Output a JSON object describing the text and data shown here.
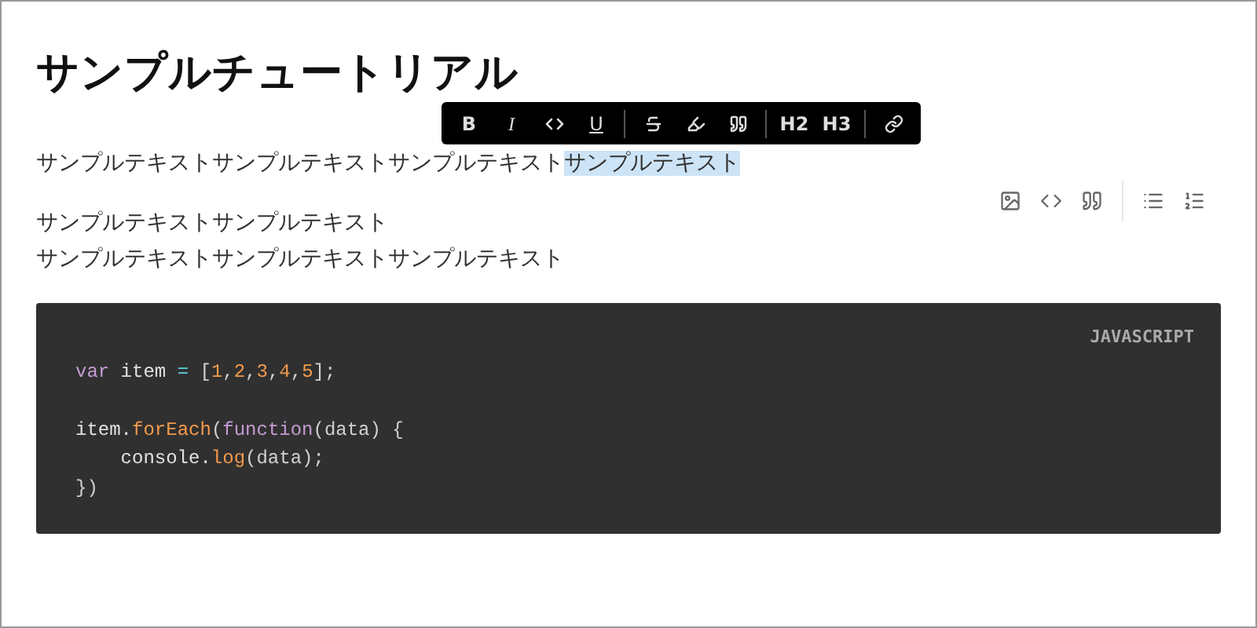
{
  "title": "サンプルチュートリアル",
  "paragraph_1": [
    {
      "text": "サンプルテキストサンプルテキストサンプルテキスト",
      "selected": false
    },
    {
      "text": "サンプルテキスト",
      "selected": true
    }
  ],
  "format_toolbar": {
    "groups": [
      [
        {
          "kind": "text",
          "label": "B"
        },
        {
          "kind": "text",
          "label": "I"
        },
        {
          "kind": "icon"
        },
        {
          "kind": "text",
          "label": "U"
        }
      ],
      [
        {
          "kind": "icon"
        },
        {
          "kind": "icon"
        },
        {
          "kind": "icon"
        }
      ],
      [
        {
          "kind": "text",
          "label": "H2"
        },
        {
          "kind": "text",
          "label": "H3"
        }
      ],
      [
        {
          "kind": "icon"
        }
      ]
    ]
  },
  "paragraph_2": [
    "サンプルテキストサンプルテキスト",
    "サンプルテキストサンプルテキストサンプルテキスト"
  ],
  "code_block": {
    "language": "JAVASCRIPT",
    "lines": [
      {
        "kind": "code",
        "tokens": [
          {
            "kind": "keyword",
            "text": "var"
          },
          {
            "kind": "plain",
            "text": " item "
          },
          {
            "kind": "operator",
            "text": "="
          },
          {
            "kind": "punct",
            "text": " ["
          },
          {
            "kind": "number",
            "text": "1"
          },
          {
            "kind": "punct",
            "text": ","
          },
          {
            "kind": "number",
            "text": "2"
          },
          {
            "kind": "punct",
            "text": ","
          },
          {
            "kind": "number",
            "text": "3"
          },
          {
            "kind": "punct",
            "text": ","
          },
          {
            "kind": "number",
            "text": "4"
          },
          {
            "kind": "punct",
            "text": ","
          },
          {
            "kind": "number",
            "text": "5"
          },
          {
            "kind": "punct",
            "text": "];"
          }
        ]
      },
      {
        "kind": "blank"
      },
      {
        "kind": "code",
        "tokens": [
          {
            "kind": "plain",
            "text": "item."
          },
          {
            "kind": "function",
            "text": "forEach"
          },
          {
            "kind": "punct",
            "text": "("
          },
          {
            "kind": "keyword",
            "text": "function"
          },
          {
            "kind": "punct",
            "text": "(data) {"
          }
        ]
      },
      {
        "kind": "code",
        "tokens": [
          {
            "kind": "plain",
            "text": "    console."
          },
          {
            "kind": "function",
            "text": "log"
          },
          {
            "kind": "punct",
            "text": "(data);"
          }
        ]
      },
      {
        "kind": "code",
        "tokens": [
          {
            "kind": "punct",
            "text": "})"
          }
        ]
      }
    ]
  }
}
